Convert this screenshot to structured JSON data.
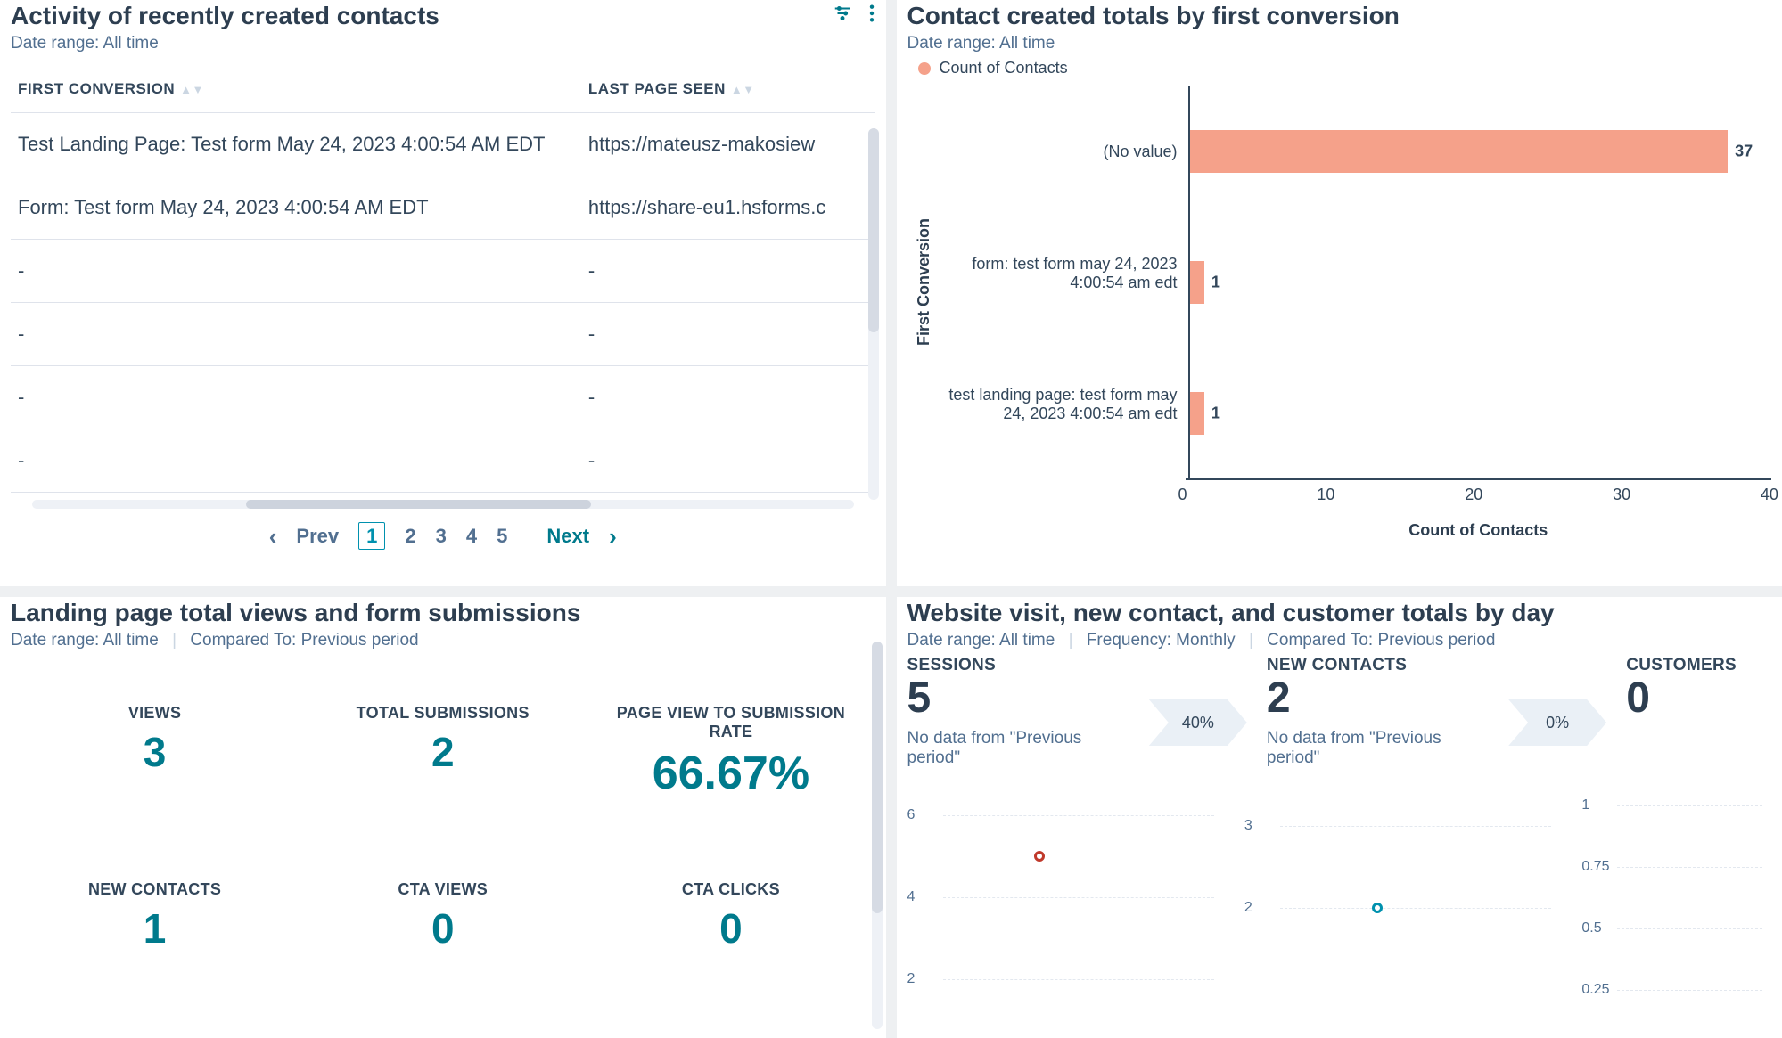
{
  "activity": {
    "title": "Activity of recently created contacts",
    "date_range": "Date range: All time",
    "columns": {
      "first_conversion": "FIRST CONVERSION",
      "last_page_seen": "LAST PAGE SEEN"
    },
    "rows": [
      {
        "first_conversion": "Test Landing Page: Test form May 24, 2023 4:00:54 AM EDT",
        "last_page_seen": "https://mateusz-makosiew"
      },
      {
        "first_conversion": "Form: Test form May 24, 2023 4:00:54 AM EDT",
        "last_page_seen": "https://share-eu1.hsforms.c"
      },
      {
        "first_conversion": "-",
        "last_page_seen": "-"
      },
      {
        "first_conversion": "-",
        "last_page_seen": "-"
      },
      {
        "first_conversion": "-",
        "last_page_seen": "-"
      },
      {
        "first_conversion": "-",
        "last_page_seen": "-"
      }
    ],
    "pagination": {
      "prev": "Prev",
      "next": "Next",
      "pages": [
        "1",
        "2",
        "3",
        "4",
        "5"
      ],
      "active": "1"
    }
  },
  "contact_totals": {
    "title": "Contact created totals by first conversion",
    "date_range": "Date range: All time",
    "legend": "Count of Contacts",
    "y_axis_label": "First Conversion",
    "x_axis_label": "Count of Contacts"
  },
  "landing": {
    "title": "Landing page total views and form submissions",
    "date_range": "Date range: All time",
    "compared_to": "Compared To: Previous period",
    "metrics": {
      "views": {
        "label": "VIEWS",
        "value": "3"
      },
      "total_submissions": {
        "label": "TOTAL SUBMISSIONS",
        "value": "2"
      },
      "rate": {
        "label": "PAGE VIEW TO SUBMISSION RATE",
        "value": "66.67%"
      },
      "new_contacts": {
        "label": "NEW CONTACTS",
        "value": "1"
      },
      "cta_views": {
        "label": "CTA VIEWS",
        "value": "0"
      },
      "cta_clicks": {
        "label": "CTA CLICKS",
        "value": "0"
      }
    }
  },
  "website": {
    "title": "Website visit, new contact, and customer totals by day",
    "date_range": "Date range: All time",
    "frequency": "Frequency: Monthly",
    "compared_to": "Compared To: Previous period",
    "sessions": {
      "label": "SESSIONS",
      "value": "5",
      "pct": "40%",
      "note": "No data from \"Previous period\""
    },
    "new_contacts": {
      "label": "NEW CONTACTS",
      "value": "2",
      "pct": "0%",
      "note": "No data from \"Previous period\""
    },
    "customers": {
      "label": "CUSTOMERS",
      "value": "0"
    },
    "mini": {
      "sessions_ticks": [
        "6",
        "4",
        "2"
      ],
      "contacts_ticks": [
        "3",
        "2"
      ],
      "customers_ticks": [
        "1",
        "0.75",
        "0.5",
        "0.25"
      ]
    }
  },
  "chart_data": {
    "type": "bar",
    "orientation": "horizontal",
    "title": "Contact created totals by first conversion",
    "xlabel": "Count of Contacts",
    "ylabel": "First Conversion",
    "xlim": [
      0,
      40
    ],
    "xticks": [
      0,
      10,
      20,
      30,
      40
    ],
    "series": [
      {
        "name": "Count of Contacts",
        "color": "#f5a18a",
        "categories": [
          "(No value)",
          "form: test form may 24, 2023 4:00:54 am edt",
          "test landing page: test form may 24, 2023 4:00:54 am edt"
        ],
        "values": [
          37,
          1,
          1
        ]
      }
    ]
  }
}
